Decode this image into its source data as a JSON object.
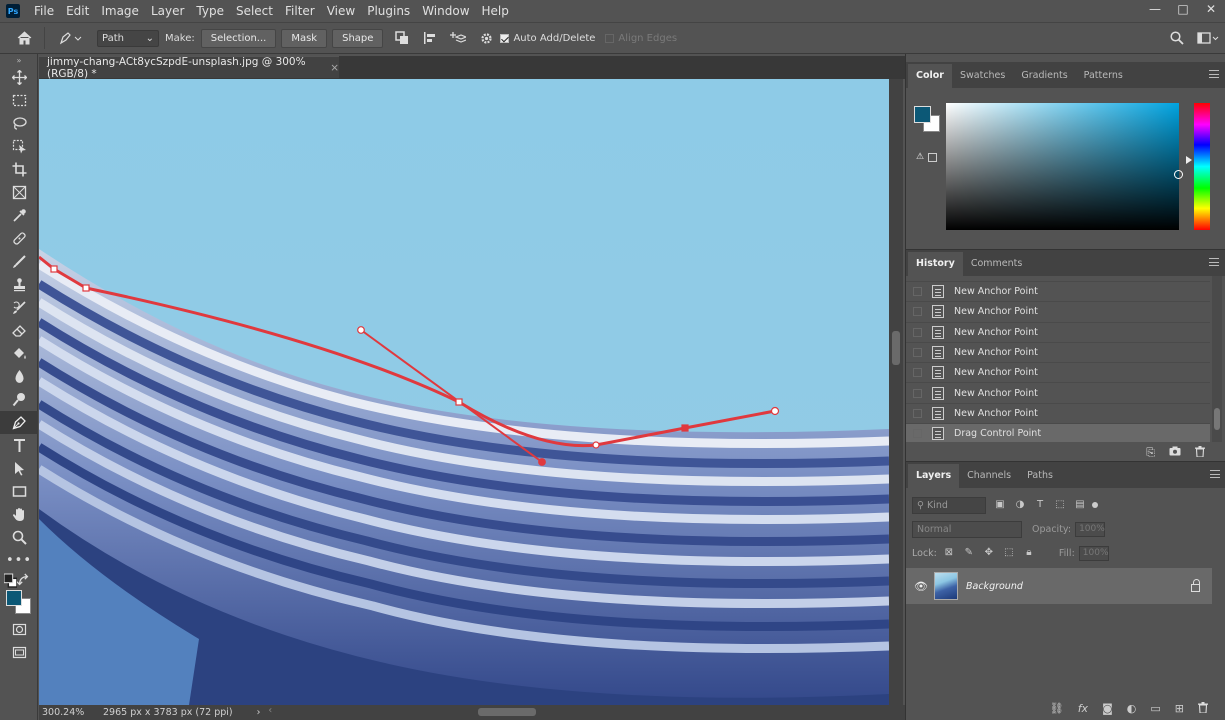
{
  "app": {
    "logo": "Ps"
  },
  "menu": [
    "File",
    "Edit",
    "Image",
    "Layer",
    "Type",
    "Select",
    "Filter",
    "View",
    "Plugins",
    "Window",
    "Help"
  ],
  "window_controls": [
    "—",
    "□",
    "✕"
  ],
  "options": {
    "mode_value": "Path",
    "make_label": "Make:",
    "selection_btn": "Selection...",
    "mask_btn": "Mask",
    "shape_btn": "Shape",
    "auto_add_label": "Auto Add/Delete",
    "align_edges_label": "Align Edges"
  },
  "document": {
    "tab_title": "jimmy-chang-ACt8ycSzpdE-unsplash.jpg @ 300% (RGB/8) *",
    "close": "×",
    "zoom": "300.24%",
    "info": "2965 px x 3783 px (72 ppi)"
  },
  "colors": {
    "foreground": "#0c5876",
    "background": "#ffffff",
    "path_stroke": "#e0393e",
    "sky": "#8fc9e4"
  },
  "panels": {
    "color_tabs": [
      "Color",
      "Swatches",
      "Gradients",
      "Patterns"
    ],
    "history_tabs": [
      "History",
      "Comments"
    ],
    "layers_tabs": [
      "Layers",
      "Channels",
      "Paths"
    ]
  },
  "history": {
    "items": [
      "New Anchor Point",
      "New Anchor Point",
      "New Anchor Point",
      "New Anchor Point",
      "New Anchor Point",
      "New Anchor Point",
      "New Anchor Point",
      "Drag Control Point"
    ],
    "selected_index": 7
  },
  "layers": {
    "kind_label": "Kind",
    "blend_mode": "Normal",
    "opacity_label": "Opacity:",
    "opacity_value": "100%",
    "lock_label": "Lock:",
    "fill_label": "Fill:",
    "fill_value": "100%",
    "items": [
      {
        "name": "Background",
        "visible": true,
        "locked": true
      }
    ]
  }
}
